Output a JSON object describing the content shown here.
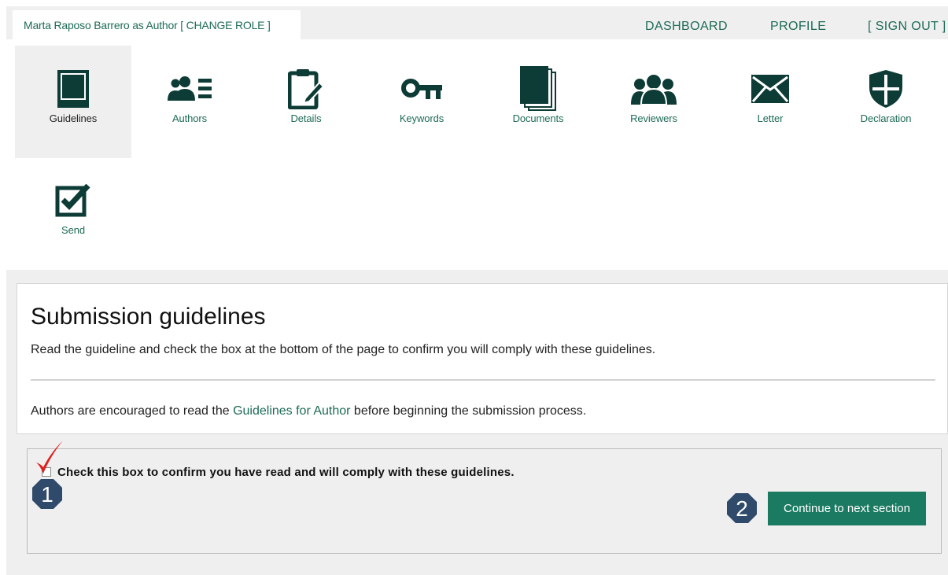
{
  "header": {
    "user_role_text": "Marta Raposo Barrero as Author [ CHANGE ROLE ]",
    "nav": {
      "dashboard": "DASHBOARD",
      "profile": "PROFILE",
      "sign_out": "[ SIGN OUT ]"
    }
  },
  "steps": [
    {
      "label": "Guidelines",
      "icon": "book-icon",
      "active": true
    },
    {
      "label": "Authors",
      "icon": "authors-card-icon",
      "active": false
    },
    {
      "label": "Details",
      "icon": "clipboard-edit-icon",
      "active": false
    },
    {
      "label": "Keywords",
      "icon": "key-icon",
      "active": false
    },
    {
      "label": "Documents",
      "icon": "documents-stack-icon",
      "active": false
    },
    {
      "label": "Reviewers",
      "icon": "reviewers-group-icon",
      "active": false
    },
    {
      "label": "Letter",
      "icon": "envelope-icon",
      "active": false
    },
    {
      "label": "Declaration",
      "icon": "shield-icon",
      "active": false
    },
    {
      "label": "Send",
      "icon": "checkbox-send-icon",
      "active": false
    }
  ],
  "guidelines": {
    "title": "Submission guidelines",
    "intro": "Read the guideline and check the box at the bottom of the page to confirm you will comply with these guidelines.",
    "authors_note_before": "Authors are encouraged to read the ",
    "authors_note_link": "Guidelines for Author",
    "authors_note_after": " before beginning the submission process."
  },
  "confirm": {
    "checkbox_label": "Check this box to confirm you have read and will comply with these guidelines.",
    "checked": false,
    "continue_button": "Continue to next section"
  },
  "annotations": {
    "badge_1": "1",
    "badge_2": "2"
  },
  "colors": {
    "accent": "#1d6b57",
    "button": "#1b7a62",
    "badge": "#2f4a6b",
    "annotation_check": "#e0201f"
  }
}
